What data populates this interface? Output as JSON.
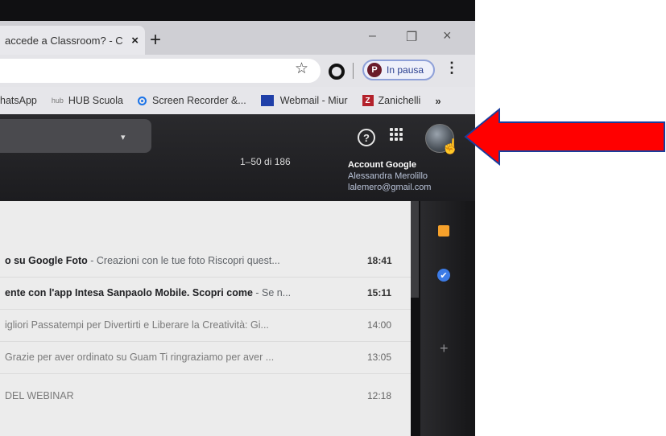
{
  "browser": {
    "tab_title": "accede a Classroom? - C",
    "tab_close": "×",
    "new_tab": "+",
    "window_minimize": "–",
    "window_restore": "❐",
    "window_close": "×",
    "star_icon": "☆",
    "profile_initial": "P",
    "profile_status": "In pausa",
    "menu_icon": "⋮"
  },
  "bookmarks": {
    "items": [
      "hatsApp",
      "HUB Scuola",
      "Screen Recorder &...",
      "Webmail - Miur",
      "Zanichelli"
    ],
    "hub_prefix": "hub",
    "zanichelli_letter": "Z",
    "more": "»"
  },
  "gmail": {
    "search_caret": "▾",
    "help_glyph": "?",
    "page_count": "1–50 di 186",
    "account_tooltip": {
      "title": "Account Google",
      "name": "Alessandra Merolillo",
      "email": "lalemero@gmail.com"
    },
    "cursor_glyph": "☝",
    "tasks_glyph": "✔",
    "add_glyph": "+",
    "rows": [
      {
        "sender_subject": "o su Google Foto",
        "snippet": " - Creazioni con le tue foto Riscopri quest...",
        "time": "18:41",
        "unread": true
      },
      {
        "sender_subject": "ente con l'app Intesa Sanpaolo Mobile. Scopri come",
        "snippet": " - Se n...",
        "time": "15:11",
        "unread": true
      },
      {
        "sender_subject": "",
        "snippet": "igliori Passatempi per Divertirti e Liberare la Creatività: Gi...",
        "time": "14:00",
        "unread": false
      },
      {
        "sender_subject": "",
        "snippet": "Grazie per aver ordinato su Guam Ti ringraziamo per aver ...",
        "time": "13:05",
        "unread": false
      },
      {
        "sender_subject": "",
        "snippet": "DEL WEBINAR",
        "time": "12:18",
        "unread": false
      }
    ]
  },
  "colors": {
    "arrow_red": "#ff0000",
    "accent_blue": "#1a73e8"
  }
}
